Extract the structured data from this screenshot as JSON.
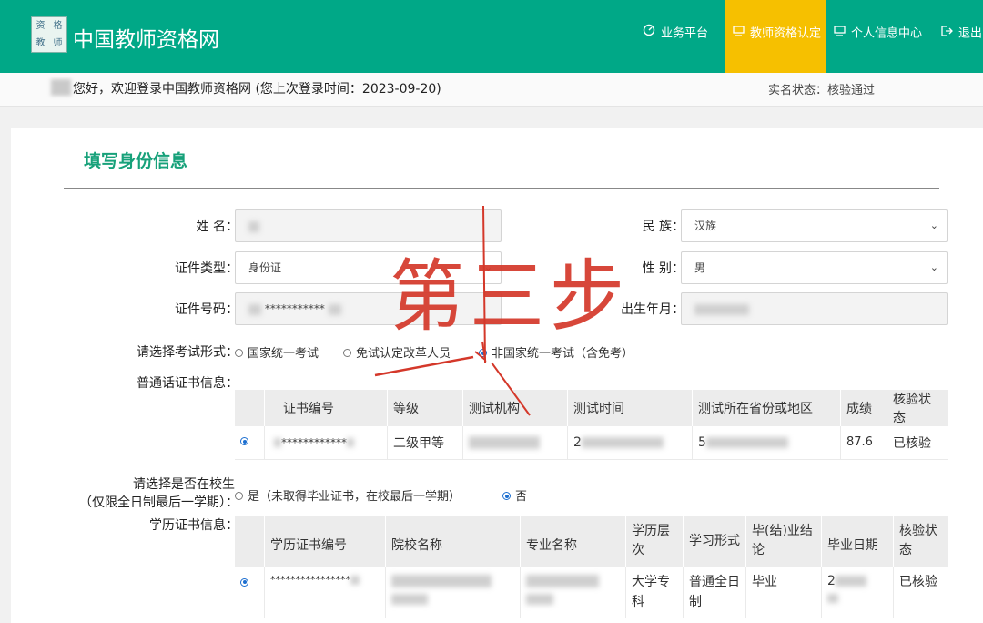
{
  "header": {
    "logo_chars": [
      "资",
      "格",
      "教",
      "师"
    ],
    "site_title": "中国教师资格网",
    "nav": [
      {
        "label": "业务平台",
        "icon": "dashboard-icon"
      },
      {
        "label": "教师资格认定",
        "icon": "monitor-icon",
        "active": true
      },
      {
        "label": "个人信息中心",
        "icon": "monitor-icon"
      },
      {
        "label": "退出",
        "icon": "logout-icon"
      }
    ]
  },
  "welcome": {
    "text": "您好，欢迎登录中国教师资格网 (您上次登录时间：2023-09-20)",
    "realname_status": "实名状态：核验通过"
  },
  "form": {
    "section_title": "填写身份信息",
    "name_label": "姓  名：",
    "ethnicity_label": "民  族：",
    "ethnicity_value": "汉族",
    "id_type_label": "证件类型：",
    "id_type_value": "身份证",
    "gender_label": "性  别：",
    "gender_value": "男",
    "id_number_label": "证件号码：",
    "id_number_value": "*********** ",
    "birth_label": "出生年月：",
    "exam_form_label": "请选择考试形式：",
    "exam_options": [
      "国家统一考试",
      "免试认定改革人员",
      "非国家统一考试（含免考）"
    ],
    "mandarin_label": "普通话证书信息：",
    "mandarin_table": {
      "headers": [
        "证书编号",
        "等级",
        "测试机构",
        "测试时间",
        "测试所在省份或地区",
        "成绩",
        "核验状态"
      ],
      "row": {
        "cert_no": "************",
        "level": "二级甲等",
        "time_prefix": "2",
        "region_prefix": "5",
        "score": "87.6",
        "status": "已核验"
      }
    },
    "in_school_label_1": "请选择是否在校生",
    "in_school_label_2": "（仅限全日制最后一学期）：",
    "in_school_options": [
      "是（未取得毕业证书，在校最后一学期）",
      "否"
    ],
    "education_label": "学历证书信息：",
    "education_table": {
      "headers": [
        "学历证书编号",
        "院校名称",
        "专业名称",
        "学历层次",
        "学习形式",
        "毕(结)业结论",
        "毕业日期",
        "核验状态"
      ],
      "row": {
        "cert_no": "****************",
        "level": "大学专科",
        "form": "普通全日制",
        "conclusion": "毕业",
        "date_prefix": "2",
        "status": "已核验"
      }
    }
  },
  "annotation": {
    "text": "第三步",
    "color": "#d4382a"
  }
}
